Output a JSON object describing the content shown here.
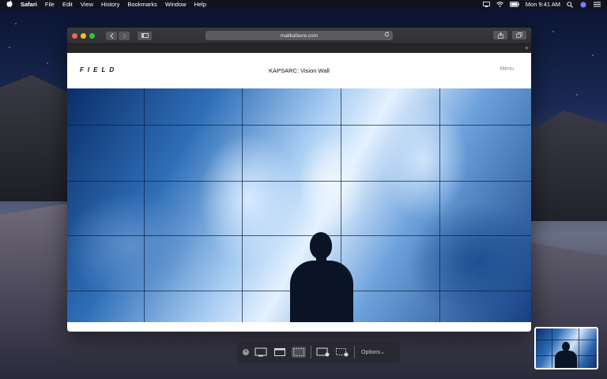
{
  "menubar": {
    "apple_icon": "apple-icon",
    "app_name": "Safari",
    "items": [
      "File",
      "Edit",
      "View",
      "History",
      "Bookmarks",
      "Window",
      "Help"
    ],
    "clock": "Mon 9:41 AM",
    "status_icons": [
      "airplay-icon",
      "wifi-icon",
      "battery-icon",
      "search-icon",
      "siri-icon",
      "control-center-icon"
    ]
  },
  "browser": {
    "url": "malikafavre.com",
    "new_tab_symbol": "+"
  },
  "site": {
    "logo": "FIELD",
    "title": "KAPSARC: Vision Wall",
    "menu": "Menu"
  },
  "capture_toolbar": {
    "options_label": "Options",
    "options_chevron": "⌄",
    "close_symbol": "×"
  }
}
